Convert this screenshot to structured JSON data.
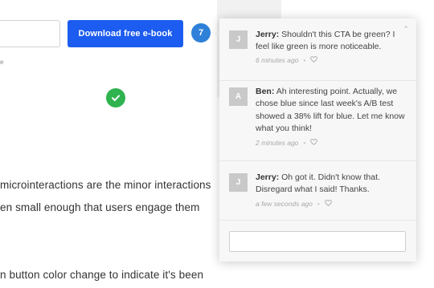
{
  "hero": {
    "cta_label": "Download free e-book",
    "subtext": "e",
    "comment_count": "7"
  },
  "article": {
    "lines": [
      "microinteractions are the minor interactions",
      "en small enough that users engage them",
      "n button color change to indicate it's been"
    ]
  },
  "comments": [
    {
      "initial": "J",
      "author": "Jerry:",
      "text": "Shouldn't this CTA be green? I feel like green is more noticeable.",
      "time": "6 minutes ago"
    },
    {
      "initial": "A",
      "author": "Ben:",
      "text": "Ah interesting point. Actually, we chose blue since last week's A/B test showed a 38% lift for blue. Let me know what you think!",
      "time": "2 minutes ago"
    },
    {
      "initial": "J",
      "author": "Jerry:",
      "text": "Oh got it. Didn't know that. Disregard what I said! Thanks.",
      "time": "a few seconds ago"
    }
  ],
  "reply": {
    "value": "",
    "placeholder": ""
  },
  "icons": {
    "check": "check-icon",
    "like": "heart-icon",
    "scroll": "chevron-up-icon"
  },
  "colors": {
    "cta": "#1d5cf0",
    "success": "#2fb34f",
    "badge": "#2f80d9"
  }
}
